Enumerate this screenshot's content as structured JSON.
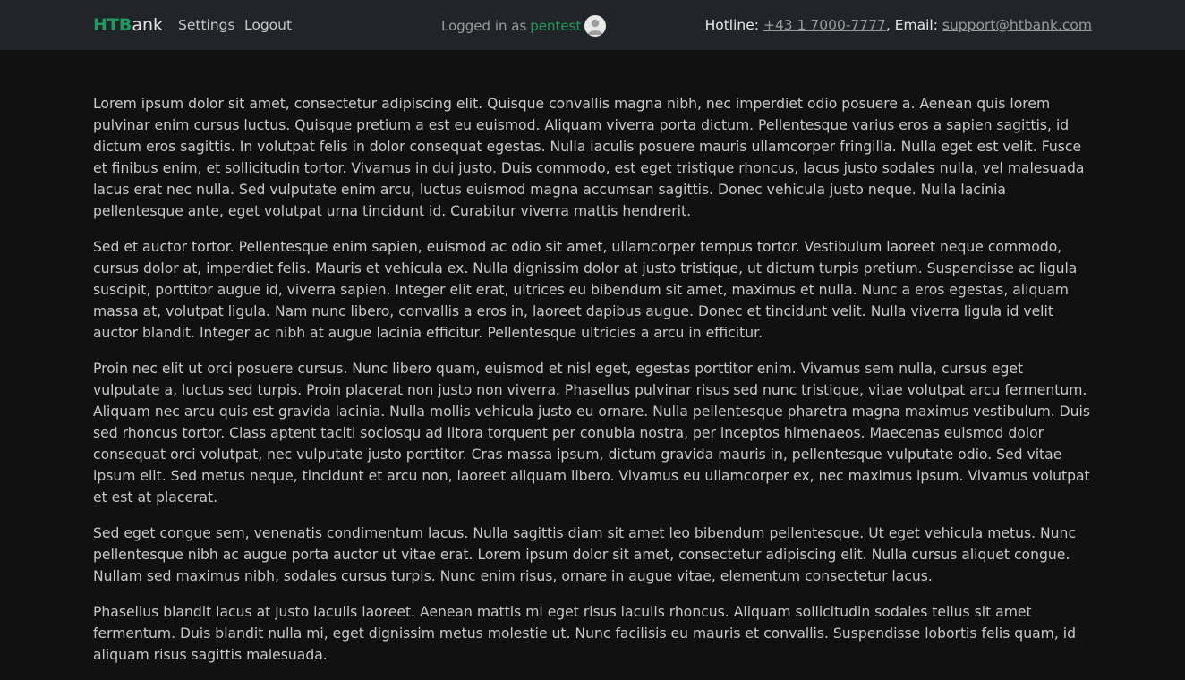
{
  "navbar": {
    "brand_accent": "HTB",
    "brand_rest": "ank",
    "settings_label": "Settings",
    "logout_label": "Logout",
    "logged_in_prefix": "Logged in as",
    "username": "pentest",
    "hotline_label": "Hotline:",
    "hotline_number": "+43 1 7000-7777",
    "email_label": ", Email:",
    "email_address": "support@htbank.com"
  },
  "main": {
    "paragraphs": [
      "Lorem ipsum dolor sit amet, consectetur adipiscing elit. Quisque convallis magna nibh, nec imperdiet odio posuere a. Aenean quis lorem pulvinar enim cursus luctus. Quisque pretium a est eu euismod. Aliquam viverra porta dictum. Pellentesque varius eros a sapien sagittis, id dictum eros sagittis. In volutpat felis in dolor consequat egestas. Nulla iaculis posuere mauris ullamcorper fringilla. Nulla eget est velit. Fusce et finibus enim, et sollicitudin tortor. Vivamus in dui justo. Duis commodo, est eget tristique rhoncus, lacus justo sodales nulla, vel malesuada lacus erat nec nulla. Sed vulputate enim arcu, luctus euismod magna accumsan sagittis. Donec vehicula justo neque. Nulla lacinia pellentesque ante, eget volutpat urna tincidunt id. Curabitur viverra mattis hendrerit.",
      "Sed et auctor tortor. Pellentesque enim sapien, euismod ac odio sit amet, ullamcorper tempus tortor. Vestibulum laoreet neque commodo, cursus dolor at, imperdiet felis. Mauris et vehicula ex. Nulla dignissim dolor at justo tristique, ut dictum turpis pretium. Suspendisse ac ligula suscipit, porttitor augue id, viverra sapien. Integer elit erat, ultrices eu bibendum sit amet, maximus et nulla. Nunc a eros egestas, aliquam massa at, volutpat ligula. Nam nunc libero, convallis a eros in, laoreet dapibus augue. Donec et tincidunt velit. Nulla viverra ligula id velit auctor blandit. Integer ac nibh at augue lacinia efficitur. Pellentesque ultricies a arcu in efficitur.",
      "Proin nec elit ut orci posuere cursus. Nunc libero quam, euismod et nisl eget, egestas porttitor enim. Vivamus sem nulla, cursus eget vulputate a, luctus sed turpis. Proin placerat non justo non viverra. Phasellus pulvinar risus sed nunc tristique, vitae volutpat arcu fermentum. Aliquam nec arcu quis est gravida lacinia. Nulla mollis vehicula justo eu ornare. Nulla pellentesque pharetra magna maximus vestibulum. Duis sed rhoncus tortor. Class aptent taciti sociosqu ad litora torquent per conubia nostra, per inceptos himenaeos. Maecenas euismod dolor consequat orci volutpat, nec vulputate justo porttitor. Cras massa ipsum, dictum gravida mauris in, pellentesque vulputate odio. Sed vitae ipsum elit. Sed metus neque, tincidunt et arcu non, laoreet aliquam libero. Vivamus eu ullamcorper ex, nec maximus ipsum. Vivamus volutpat et est at placerat.",
      "Sed eget congue sem, venenatis condimentum lacus. Nulla sagittis diam sit amet leo bibendum pellentesque. Ut eget vehicula metus. Nunc pellentesque nibh ac augue porta auctor ut vitae erat. Lorem ipsum dolor sit amet, consectetur adipiscing elit. Nulla cursus aliquet congue. Nullam sed maximus nibh, sodales cursus turpis. Nunc enim risus, ornare in augue vitae, elementum consectetur lacus.",
      "Phasellus blandit lacus at justo iaculis laoreet. Aenean mattis mi eget risus iaculis rhoncus. Aliquam sollicitudin sodales tellus sit amet fermentum. Duis blandit nulla mi, eget dignissim metus molestie ut. Nunc facilisis eu mauris et convallis. Suspendisse lobortis felis quam, id aliquam risus sagittis malesuada."
    ]
  },
  "colors": {
    "page_background": "#111111",
    "navbar_background": "#212529",
    "brand_accent": "#1f9a5c",
    "text": "#c8c8c8",
    "muted_link": "#9a9a9a"
  },
  "icons": {
    "avatar": "user-avatar-icon"
  }
}
